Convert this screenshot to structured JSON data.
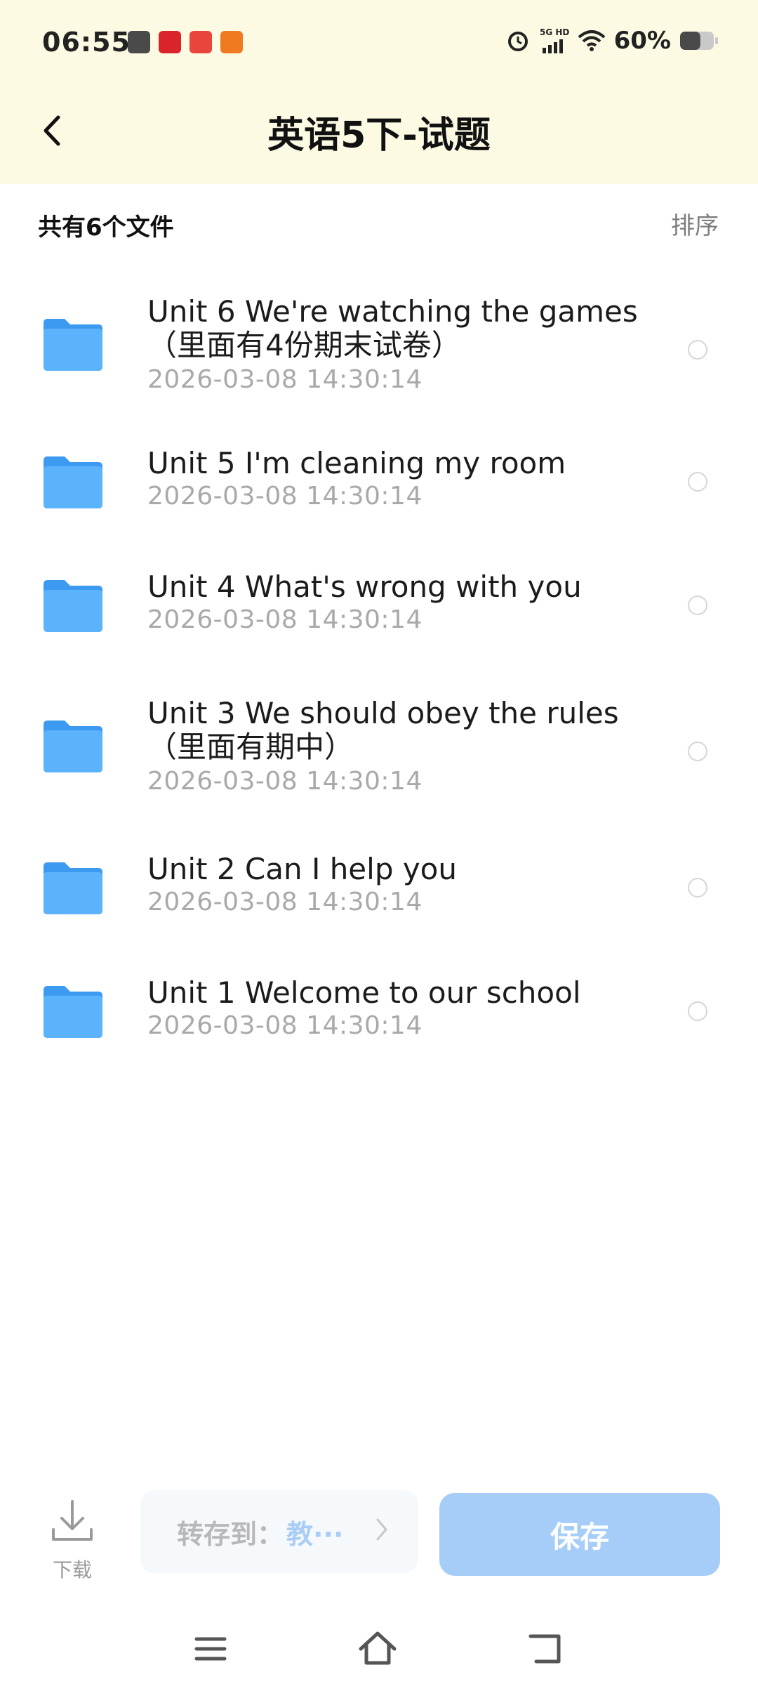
{
  "status_bar": {
    "time": "06:55",
    "network": "5G HD",
    "battery_percent": "60%",
    "battery_level": 0.6
  },
  "header": {
    "back_icon": "chevron-left-icon",
    "title": "英语5下-试题"
  },
  "list_header": {
    "count_text": "共有6个文件",
    "sort_label": "排序"
  },
  "files": [
    {
      "name_line1": "Unit 6 We're watching the games",
      "name_line2": "（里面有4份期末试卷）",
      "date": "2026-03-08  14:30:14"
    },
    {
      "name_line1": "Unit 5 I'm cleaning my room",
      "name_line2": "",
      "date": "2026-03-08  14:30:14"
    },
    {
      "name_line1": "Unit 4 What's wrong with you",
      "name_line2": "",
      "date": "2026-03-08  14:30:14"
    },
    {
      "name_line1": "Unit 3 We should obey the rules",
      "name_line2": "（里面有期中）",
      "date": "2026-03-08  14:30:14"
    },
    {
      "name_line1": "Unit 2 Can I help you",
      "name_line2": "",
      "date": "2026-03-08  14:30:14"
    },
    {
      "name_line1": "Unit 1 Welcome to our school",
      "name_line2": "",
      "date": "2026-03-08  14:30:14"
    }
  ],
  "bottom_bar": {
    "download_label": "下载",
    "save_to_label": "转存到：",
    "save_to_target": "教···",
    "save_label": "保存"
  },
  "colors": {
    "header_bg": "#fdfae4",
    "folder_blue": "#4aa8f5",
    "save_button": "#a5cdf8"
  }
}
